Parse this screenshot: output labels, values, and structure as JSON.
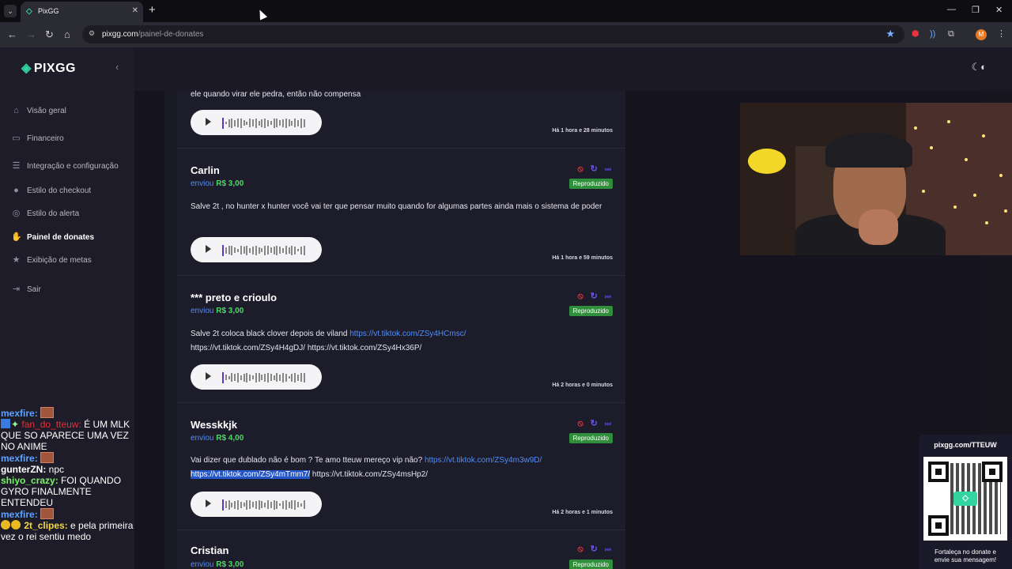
{
  "browser": {
    "tab_title": "PixGG",
    "url_domain": "pixgg.com",
    "url_path": "/painel-de-donates",
    "profile_initial": "M"
  },
  "sidebar": {
    "logo": "PIXGG",
    "items": [
      {
        "label": "Visão geral",
        "icon": "home-icon"
      },
      {
        "label": "Financeiro",
        "icon": "wallet-icon"
      },
      {
        "label": "Integração e configuração",
        "icon": "document-icon"
      },
      {
        "label": "Estilo do checkout",
        "icon": "palette-icon"
      },
      {
        "label": "Estilo do alerta",
        "icon": "palette-icon"
      },
      {
        "label": "Painel de donates",
        "icon": "donate-icon",
        "active": true
      },
      {
        "label": "Exibição de metas",
        "icon": "star-icon"
      },
      {
        "label": "Sair",
        "icon": "logout-icon"
      }
    ]
  },
  "donations": [
    {
      "name": "",
      "message": "ele quando virar ele pedra, então não compensa",
      "time": "Há 1 hora e 28 minutos"
    },
    {
      "name": "Carlin",
      "sent": "enviou",
      "amount": "R$ 3,00",
      "status": "Reproduzido",
      "message": "Salve 2t , no hunter x hunter você vai ter que pensar muito quando for algumas partes ainda mais o sistema de poder",
      "time": "Há 1 hora e 59 minutos"
    },
    {
      "name": "*** preto e crioulo",
      "sent": "enviou",
      "amount": "R$ 3,00",
      "status": "Reproduzido",
      "message_pre": "Salve 2t coloca black clover depois de viland ",
      "link1": "https://vt.tiktok.com/ZSy4HCmsc/",
      "message_post": "https://vt.tiktok.com/ZSy4H4gDJ/ https://vt.tiktok.com/ZSy4Hx36P/",
      "time": "Há 2 horas e 0 minutos"
    },
    {
      "name": "Wesskkjk",
      "sent": "enviou",
      "amount": "R$ 4,00",
      "status": "Reproduzido",
      "message_pre": "Vai dizer que dublado não é bom ? Te amo tteuw mereço vip não? ",
      "link1": "https://vt.tiktok.com/ZSy4m3w9D/",
      "link_selected": "https://vt.tiktok.com/ZSy4mTmm7/",
      "message_post": " https://vt.tiktok.com/ZSy4msHp2/",
      "time": "Há 2 horas e 1 minutos"
    },
    {
      "name": "Cristian",
      "sent": "enviou",
      "amount": "R$ 3,00",
      "status": "Reproduzido"
    }
  ],
  "chat": [
    {
      "user": "mexfire:",
      "text": ""
    },
    {
      "user": "fan_do_tteuw:",
      "text": " É UM MLK QUE SO APARECE UMA VEZ NO ANIME"
    },
    {
      "user": "mexfire:",
      "text": ""
    },
    {
      "user": "gunterZN:",
      "text": " npc"
    },
    {
      "user": "shiyo_crazy:",
      "text": " FOI QUANDO GYRO FINALMENTE ENTENDEU"
    },
    {
      "user": "mexfire:",
      "text": ""
    },
    {
      "user": "2t_clipes:",
      "text": " e pela primeira vez o rei sentiu medo"
    }
  ],
  "qr_panel": {
    "title": "pixgg.com/TTEUW",
    "caption_line1": "Fortaleça no donate e",
    "caption_line2": "envie sua mensagem!"
  },
  "colors": {
    "accent": "#32d5a0",
    "link": "#4f8ef7",
    "amount": "#4cd964",
    "badge": "#2f8f3a",
    "block": "#e8333a"
  }
}
